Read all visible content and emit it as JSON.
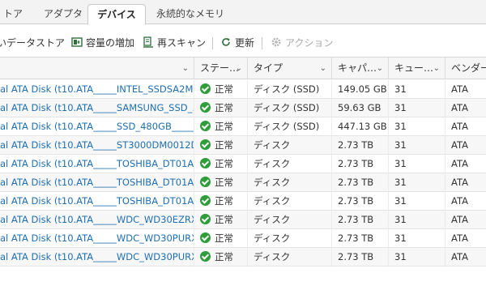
{
  "tabs": [
    {
      "label": "トア"
    },
    {
      "label": "アダプタ"
    },
    {
      "label": "デバイス",
      "active": true
    },
    {
      "label": "永続的なメモリ"
    }
  ],
  "toolbar": {
    "create_datastore": "いデータストア",
    "increase_capacity": "容量の増加",
    "rescan": "再スキャン",
    "refresh": "更新",
    "actions": "アクション"
  },
  "table": {
    "columns": [
      "",
      "ステー…",
      "タイプ",
      "キャパ…",
      "キュー…",
      "ベンダー"
    ],
    "rows": [
      {
        "name": "al ATA Disk (t10.ATA_____INTEL_SSDSA2M…",
        "status": "正常",
        "type": "ディスク (SSD)",
        "capacity": "149.05 GB",
        "queue": "31",
        "vendor": "ATA"
      },
      {
        "name": "al ATA Disk (t10.ATA_____SAMSUNG_SSD_…",
        "status": "正常",
        "type": "ディスク (SSD)",
        "capacity": "59.63 GB",
        "queue": "31",
        "vendor": "ATA"
      },
      {
        "name": "al ATA Disk (t10.ATA_____SSD_480GB_____…",
        "status": "正常",
        "type": "ディスク (SSD)",
        "capacity": "447.13 GB",
        "queue": "31",
        "vendor": "ATA"
      },
      {
        "name": "al ATA Disk (t10.ATA_____ST3000DM0012D9…",
        "status": "正常",
        "type": "ディスク",
        "capacity": "2.73 TB",
        "queue": "31",
        "vendor": "ATA"
      },
      {
        "name": "al ATA Disk (t10.ATA_____TOSHIBA_DT01A…",
        "status": "正常",
        "type": "ディスク",
        "capacity": "2.73 TB",
        "queue": "31",
        "vendor": "ATA"
      },
      {
        "name": "al ATA Disk (t10.ATA_____TOSHIBA_DT01A…",
        "status": "正常",
        "type": "ディスク",
        "capacity": "2.73 TB",
        "queue": "31",
        "vendor": "ATA"
      },
      {
        "name": "al ATA Disk (t10.ATA_____TOSHIBA_DT01A…",
        "status": "正常",
        "type": "ディスク",
        "capacity": "2.73 TB",
        "queue": "31",
        "vendor": "ATA"
      },
      {
        "name": "al ATA Disk (t10.ATA_____WDC_WD30EZRX…",
        "status": "正常",
        "type": "ディスク",
        "capacity": "2.73 TB",
        "queue": "31",
        "vendor": "ATA"
      },
      {
        "name": "al ATA Disk (t10.ATA_____WDC_WD30PURX…",
        "status": "正常",
        "type": "ディスク",
        "capacity": "2.73 TB",
        "queue": "31",
        "vendor": "ATA"
      },
      {
        "name": "al ATA Disk (t10.ATA_____WDC_WD30PURX…",
        "status": "正常",
        "type": "ディスク",
        "capacity": "2.73 TB",
        "queue": "31",
        "vendor": "ATA"
      }
    ]
  },
  "colors": {
    "link": "#1f6fb2",
    "status_ok": "#2e9d3a",
    "disabled": "#a9a9a9"
  },
  "icons": [
    "datastore-add-icon",
    "capacity-increase-icon",
    "rescan-icon",
    "refresh-icon",
    "actions-gear-icon",
    "status-ok-icon",
    "chevron-down-icon"
  ]
}
